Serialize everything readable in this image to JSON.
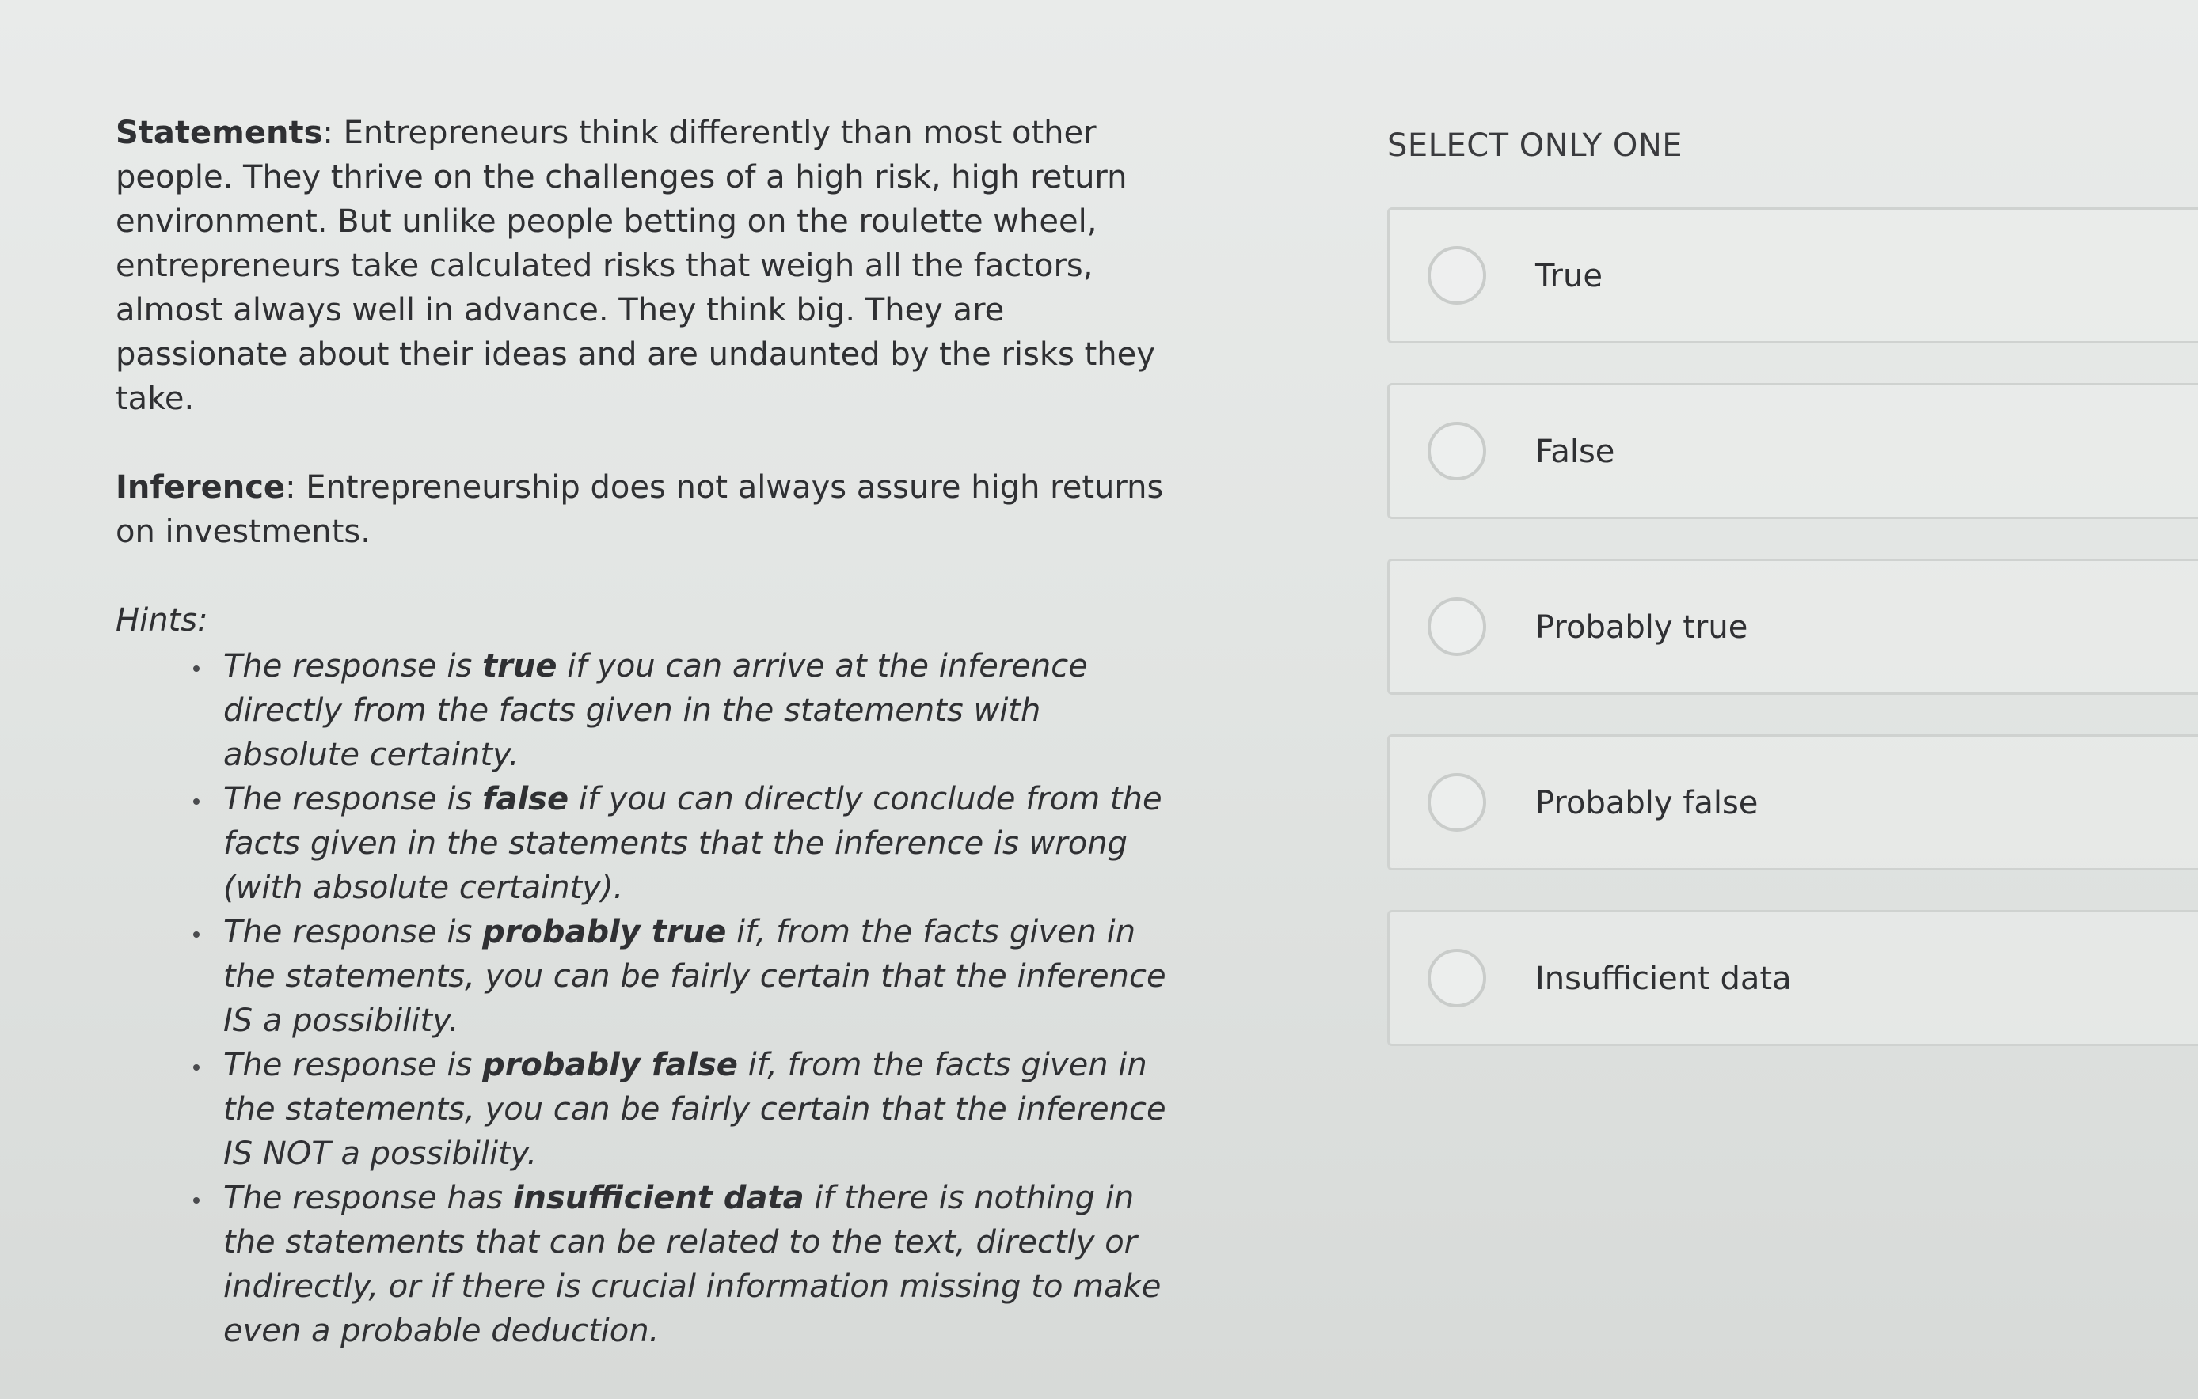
{
  "question": {
    "statements_label": "Statements",
    "statements_text": ": Entrepreneurs think differently than most other people. They thrive on the challenges of a high risk, high return environment. But unlike people betting on the roulette wheel, entrepreneurs take calculated risks that weigh all the factors, almost always well in advance. They think big. They are passionate about their ideas and are undaunted by the risks they take.",
    "inference_label": "Inference",
    "inference_text": ": Entrepreneurship does not always assure high returns on investments."
  },
  "hints": {
    "title": "Hints:",
    "items": [
      {
        "pre": "The response is ",
        "bold": "true",
        "post": " if you can arrive at the inference directly from the facts given in the statements with absolute certainty."
      },
      {
        "pre": "The response is ",
        "bold": "false",
        "post": " if you can directly conclude from the facts given in the statements that the inference is wrong (with absolute certainty)."
      },
      {
        "pre": "The response is ",
        "bold": "probably true",
        "post": " if, from the facts given in the statements, you can be fairly certain that the inference IS a possibility."
      },
      {
        "pre": "The response is ",
        "bold": "probably false",
        "post": " if, from the facts given in the statements, you can be fairly certain that the inference IS NOT a possibility."
      },
      {
        "pre": "The response has ",
        "bold": "insufficient data",
        "post": " if there is nothing in the statements that can be related to the text, directly or indirectly, or if there is crucial information missing to make even a probable deduction."
      }
    ]
  },
  "answer": {
    "instruction": "SELECT ONLY ONE",
    "options": [
      {
        "label": "True",
        "selected": false
      },
      {
        "label": "False",
        "selected": false
      },
      {
        "label": "Probably true",
        "selected": false
      },
      {
        "label": "Probably false",
        "selected": false
      },
      {
        "label": "Insufficient data",
        "selected": false
      }
    ]
  }
}
